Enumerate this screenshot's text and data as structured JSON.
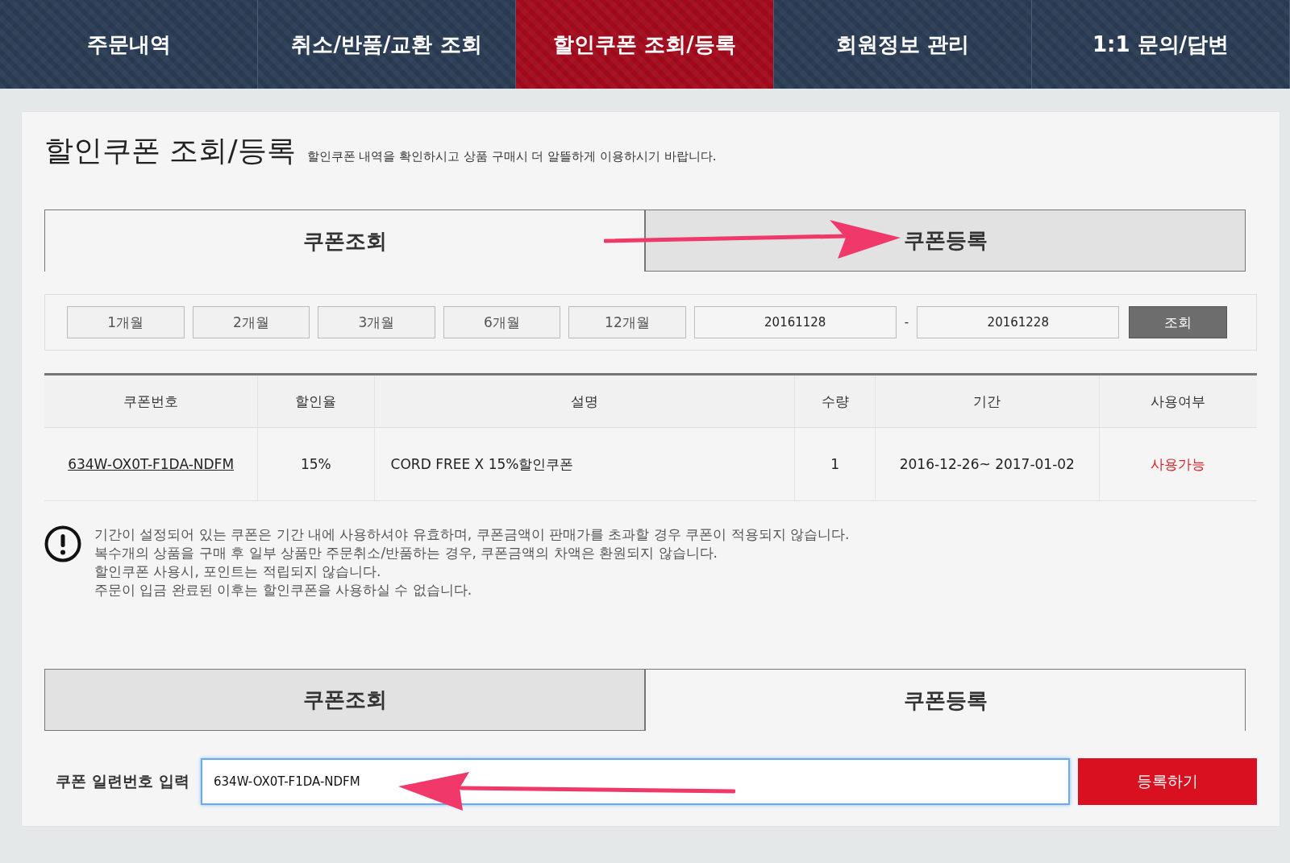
{
  "nav": [
    {
      "label": "주문내역",
      "selected": false
    },
    {
      "label": "취소/반품/교환 조회",
      "selected": false
    },
    {
      "label": "할인쿠폰 조회/등록",
      "selected": true
    },
    {
      "label": "회원정보 관리",
      "selected": false
    },
    {
      "label": "1:1 문의/답변",
      "selected": false
    }
  ],
  "title": "할인쿠폰 조회/등록",
  "subtitle": "할인쿠폰 내역을 확인하시고 상품 구매시 더 알뜰하게 이용하시기 바랍니다.",
  "tabs_top": [
    {
      "label": "쿠폰조회",
      "selected": true
    },
    {
      "label": "쿠폰등록",
      "selected": false
    }
  ],
  "filter": {
    "periods": [
      "1개월",
      "2개월",
      "3개월",
      "6개월",
      "12개월"
    ],
    "date_from": "20161128",
    "separator": "-",
    "date_to": "20161228",
    "search_button": "조회"
  },
  "table": {
    "columns": [
      "쿠폰번호",
      "할인율",
      "설명",
      "수량",
      "기간",
      "사용여부"
    ],
    "rows": [
      {
        "code": "634W-OX0T-F1DA-NDFM",
        "rate": "15%",
        "description": "CORD FREE X 15%할인쿠폰",
        "quantity": "1",
        "period": "2016-12-26~ 2017-01-02",
        "status": "사용가능"
      }
    ]
  },
  "notices": [
    "기간이 설정되어 있는 쿠폰은 기간 내에 사용하셔야 유효하며, 쿠폰금액이 판매가를 초과할 경우 쿠폰이 적용되지 않습니다.",
    "복수개의 상품을 구매 후 일부 상품만 주문취소/반품하는 경우, 쿠폰금액의 차액은 환원되지 않습니다.",
    "할인쿠폰 사용시, 포인트는 적립되지 않습니다.",
    "주문이 입금 완료된 이후는 할인쿠폰을 사용하실 수 없습니다."
  ],
  "tabs_bottom": [
    {
      "label": "쿠폰조회",
      "selected": false
    },
    {
      "label": "쿠폰등록",
      "selected": true
    }
  ],
  "register": {
    "label": "쿠폰 일련번호 입력",
    "value": "634W-OX0T-F1DA-NDFM",
    "button": "등록하기"
  }
}
